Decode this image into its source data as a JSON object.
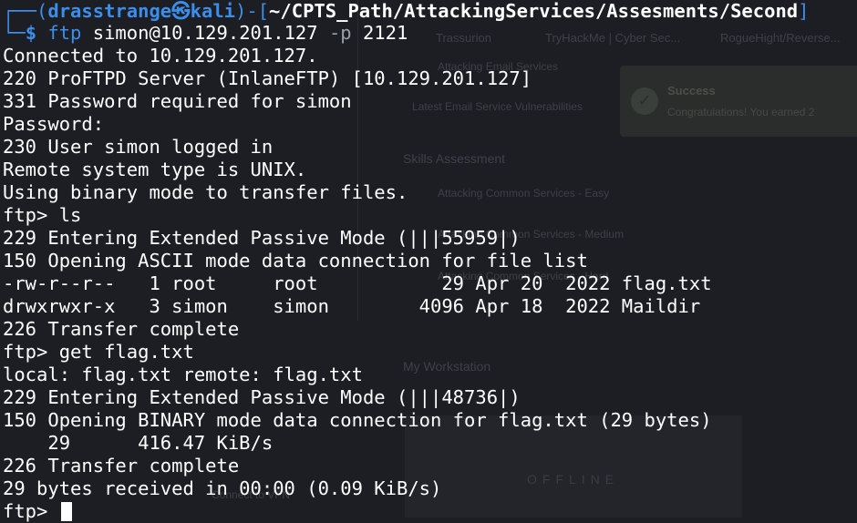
{
  "background": {
    "tabs": [
      "Trassurion",
      "TryHackMe | Cyber Sec...",
      "RogueHight/Reverse..."
    ],
    "items": [
      "Attacking Email Services",
      "Latest Email Service Vulnerabilities"
    ],
    "section_skills": "Skills Assessment",
    "skill_items": [
      "Attacking Common Services - Easy",
      "Attacking Common Services - Medium",
      "Attacking Common Services - Hard"
    ],
    "section_workstation": "My Workstation",
    "workstation_status": "OFFLINE",
    "toast_title": "Success",
    "toast_text": "Congratulations! You earned 2",
    "footer_item": "Connect to VPN"
  },
  "terminal": {
    "prompt": {
      "corner_top": "┌──(",
      "user": "drasstrange",
      "at_glyph": "㉿",
      "host": "kali",
      "mid": ")-[",
      "path": "~/CPTS_Path/AttackingServices/Assesments/Second",
      "end": "]",
      "corner_bottom": "└─",
      "dollar": "$",
      "cmd": "ftp",
      "arg": "simon@10.129.201.127",
      "flag": "-p",
      "port": "2121"
    },
    "lines": [
      "Connected to 10.129.201.127.",
      "220 ProFTPD Server (InlaneFTP) [10.129.201.127]",
      "331 Password required for simon",
      "Password:",
      "230 User simon logged in",
      "Remote system type is UNIX.",
      "Using binary mode to transfer files.",
      "ftp> ls",
      "229 Entering Extended Passive Mode (|||55959|)",
      "150 Opening ASCII mode data connection for file list",
      "-rw-r--r--   1 root     root           29 Apr 20  2022 flag.txt",
      "drwxrwxr-x   3 simon    simon        4096 Apr 18  2022 Maildir",
      "226 Transfer complete",
      "ftp> get flag.txt",
      "local: flag.txt remote: flag.txt",
      "229 Entering Extended Passive Mode (|||48736|)",
      "150 Opening BINARY mode data connection for flag.txt (29 bytes)",
      "    29      416.47 KiB/s",
      "226 Transfer complete",
      "29 bytes received in 00:00 (0.09 KiB/s)"
    ],
    "final_prompt": "ftp> "
  }
}
